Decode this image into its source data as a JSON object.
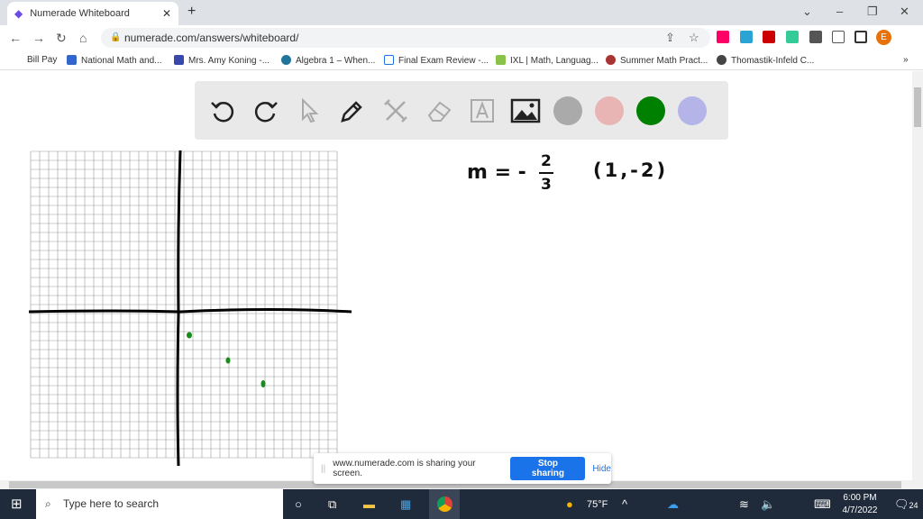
{
  "browser": {
    "tab_title": "Numerade Whiteboard",
    "url": "numerade.com/answers/whiteboard/",
    "profile_initial": "E"
  },
  "bookmarks": [
    "Bill Pay",
    "National Math and...",
    "Mrs. Amy Koning -...",
    "Algebra 1 – When...",
    "Final Exam Review -...",
    "IXL | Math, Languag...",
    "Summer Math Pract...",
    "Thomastik-Infeld C..."
  ],
  "toolbar": {
    "tools": [
      "undo-icon",
      "redo-icon",
      "pointer-icon",
      "pen-icon",
      "tools-icon",
      "eraser-icon",
      "text-icon",
      "image-icon"
    ],
    "colors": [
      "#aaaaaa",
      "#e8b4b4",
      "#008000",
      "#b4b4e8"
    ]
  },
  "board": {
    "slope_text": "m = -",
    "numerator": "2",
    "denominator": "3",
    "point_text": "(1,-2)",
    "point_color": "#1a8a1a"
  },
  "share": {
    "message": "www.numerade.com is sharing your screen.",
    "stop": "Stop sharing",
    "hide": "Hide"
  },
  "taskbar": {
    "search_placeholder": "Type here to search",
    "weather": "75°F",
    "time": "6:00 PM",
    "date": "4/7/2022",
    "notifications": "24"
  }
}
